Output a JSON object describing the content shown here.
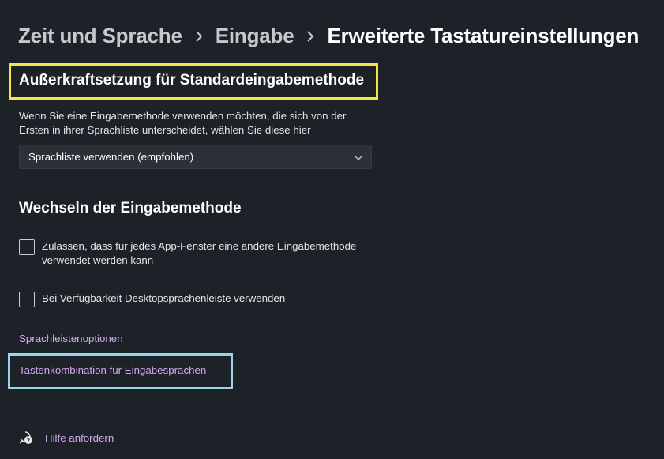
{
  "breadcrumb": {
    "items": [
      "Zeit und Sprache",
      "Eingabe",
      "Erweiterte Tastatureinstellungen"
    ]
  },
  "override_section": {
    "heading": "Außerkraftsetzung für Standardeingabemethode",
    "description": "Wenn Sie eine Eingabemethode verwenden möchten, die sich von der Ersten in ihrer Sprachliste unterscheidet, wählen Sie diese hier",
    "select_value": "Sprachliste verwenden (empfohlen)"
  },
  "switch_section": {
    "heading": "Wechseln der Eingabemethode",
    "checkboxes": [
      {
        "label": "Zulassen, dass für jedes App-Fenster eine andere Eingabemethode verwendet werden kann",
        "checked": false
      },
      {
        "label": "Bei Verfügbarkeit Desktopsprachenleiste verwenden",
        "checked": false
      }
    ]
  },
  "links": {
    "language_bar_options": "Sprachleistenoptionen",
    "input_hotkeys": "Tastenkombination für Eingabesprachen"
  },
  "help": {
    "label": "Hilfe anfordern",
    "icon": "help-chat-icon"
  },
  "colors": {
    "background": "#1d2228",
    "link": "#d6a8f2",
    "highlight_yellow": "#f5e54a",
    "highlight_blue": "#9ad3ea"
  }
}
